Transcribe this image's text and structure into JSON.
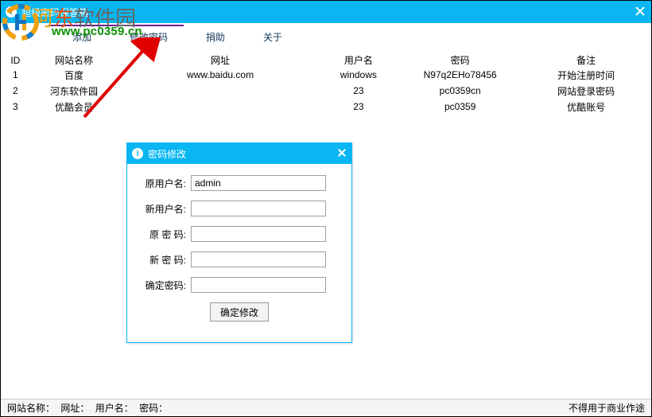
{
  "window": {
    "title": "超级密码保管箱"
  },
  "menu": {
    "add": "添加",
    "changepw": "修改密码",
    "donate": "捐助",
    "about": "关于"
  },
  "table": {
    "headers": {
      "id": "ID",
      "site": "网站名称",
      "url": "网址",
      "user": "用户名",
      "pass": "密码",
      "remark": "备注"
    },
    "rows": [
      {
        "id": "1",
        "site": "百度",
        "url": "www.baidu.com",
        "user": "windows",
        "pass": "N97q2EHo78456",
        "remark": "开始注册时间"
      },
      {
        "id": "2",
        "site": "河东软件园",
        "url": "",
        "user": "23",
        "pass": "pc0359cn",
        "remark": "网站登录密码"
      },
      {
        "id": "3",
        "site": "优酷会员",
        "url": "",
        "user": "23",
        "pass": "pc0359",
        "remark": "优酷账号"
      }
    ]
  },
  "modal": {
    "title": "密码修改",
    "labels": {
      "old_user": "原用户名:",
      "new_user": "新用户名:",
      "old_pass": "原 密 码:",
      "new_pass": "新 密 码:",
      "confirm": "确定密码:"
    },
    "values": {
      "old_user": "admin",
      "new_user": "",
      "old_pass": "",
      "new_pass": "",
      "confirm": ""
    },
    "submit": "确定修改"
  },
  "status": {
    "site_lbl": "网站名称：",
    "url_lbl": "网址：",
    "user_lbl": "用户名：",
    "pass_lbl": "密码：",
    "right": "不得用于商业作途"
  },
  "watermark": {
    "text": "河东软件园",
    "url": "www.pc0359.cn"
  }
}
